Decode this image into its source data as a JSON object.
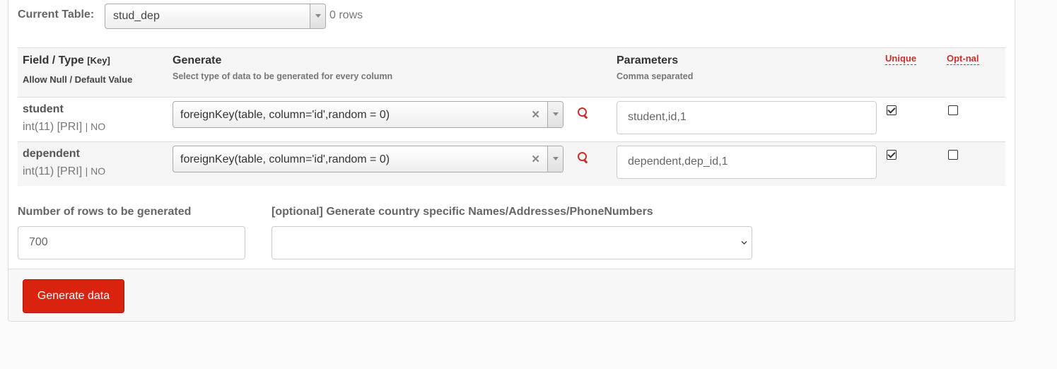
{
  "current_table": {
    "label": "Current Table:",
    "selected": "stud_dep",
    "rows_count": "0 rows"
  },
  "table_header": {
    "field_type": "Field / Type",
    "key": "[Key]",
    "null_default": "Allow Null / Default Value",
    "generate": "Generate",
    "generate_sub": "Select type of data to be generated for every column",
    "parameters": "Parameters",
    "parameters_sub": "Comma separated",
    "unique": "Unique",
    "optional": "Opt-nal"
  },
  "rows": [
    {
      "name": "student",
      "type": "int(11) [PRI]",
      "null": "| NO",
      "generator": "foreignKey(table, column='id',random = 0)",
      "parameters": "student,id,1",
      "unique": true,
      "optional": false
    },
    {
      "name": "dependent",
      "type": "int(11) [PRI]",
      "null": "| NO",
      "generator": "foreignKey(table, column='id',random = 0)",
      "parameters": "dependent,dep_id,1",
      "unique": true,
      "optional": false
    }
  ],
  "rows_to_generate": {
    "label": "Number of rows to be generated",
    "value": "700"
  },
  "country": {
    "label": "[optional] Generate country specific Names/Addresses/PhoneNumbers",
    "value": ""
  },
  "actions": {
    "generate_label": "Generate data"
  },
  "colors": {
    "primary": "#d9230f",
    "accent_text": "#c9302c"
  },
  "icons": {
    "clear": "times-icon",
    "search": "search-icon",
    "dropdown": "chevron-down-icon"
  }
}
